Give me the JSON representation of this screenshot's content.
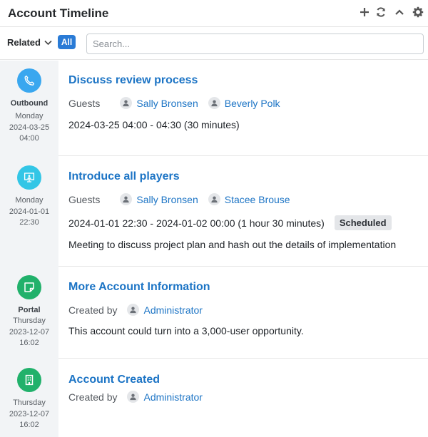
{
  "header": {
    "title": "Account Timeline",
    "icons": [
      "plus-icon",
      "refresh-icon",
      "chevron-up-icon",
      "gear-icon"
    ]
  },
  "filter": {
    "related_label": "Related",
    "all_label": "All",
    "search_placeholder": "Search..."
  },
  "entries": [
    {
      "type_label": "Outbound",
      "day": "Monday",
      "date": "2024-03-25",
      "time": "04:00",
      "icon": "phone-icon",
      "icon_color": "#3aa7ef",
      "title": "Discuss review process",
      "meta_label": "Guests",
      "people": [
        "Sally Bronsen",
        "Beverly Polk"
      ],
      "line1": "2024-03-25 04:00 - 04:30 (30 minutes)"
    },
    {
      "type_label": "",
      "day": "Monday",
      "date": "2024-01-01",
      "time": "22:30",
      "icon": "presentation-icon",
      "icon_color": "#33c6e6",
      "title": "Introduce all players",
      "meta_label": "Guests",
      "people": [
        "Sally Bronsen",
        "Stacee Brouse"
      ],
      "line1": "2024-01-01 22:30 - 2024-01-02 00:00 (1 hour 30 minutes)",
      "badge": "Scheduled",
      "description": "Meeting to discuss project plan and hash out the details of implementation"
    },
    {
      "type_label": "Portal",
      "day": "Thursday",
      "date": "2023-12-07",
      "time": "16:02",
      "icon": "note-icon",
      "icon_color": "#21b16b",
      "title": "More Account Information",
      "meta_label": "Created by",
      "people": [
        "Administrator"
      ],
      "line1": "This account could turn into a 3,000-user opportunity."
    },
    {
      "type_label": "",
      "day": "Thursday",
      "date": "2023-12-07",
      "time": "16:02",
      "icon": "building-icon",
      "icon_color": "#21b16b",
      "title": "Account Created",
      "meta_label": "Created by",
      "people": [
        "Administrator"
      ]
    }
  ]
}
